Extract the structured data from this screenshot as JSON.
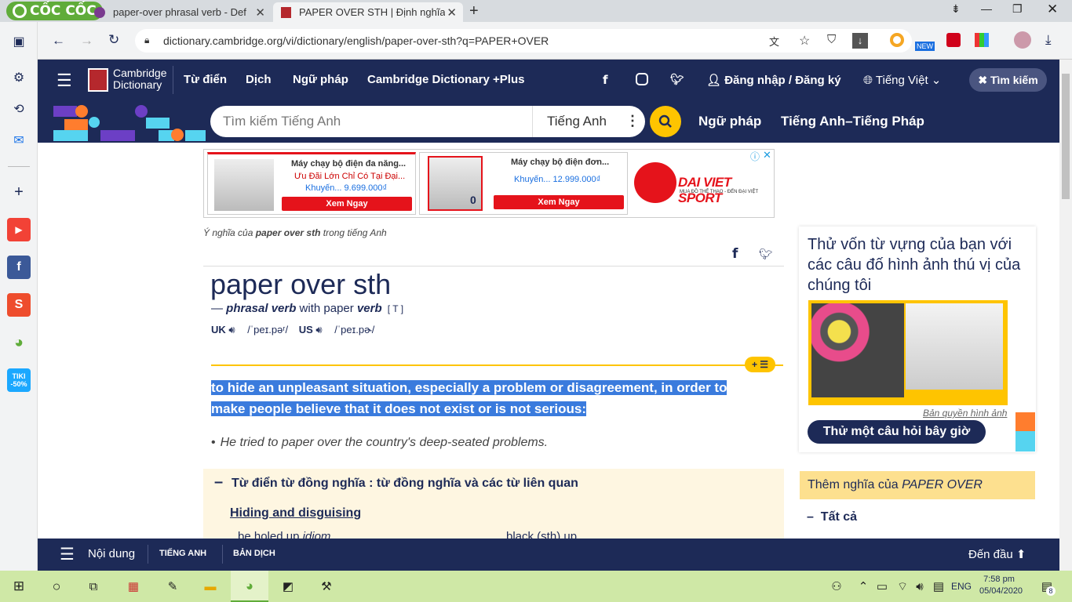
{
  "browser": {
    "brand": "CỐC CỐC",
    "tabs": [
      {
        "title": "paper-over phrasal verb - Def"
      },
      {
        "title": "PAPER OVER STH | Định nghĩa"
      }
    ],
    "url": "dictionary.cambridge.org/vi/dictionary/english/paper-over-sth?q=PAPER+OVER",
    "badge_new": "NEW",
    "sidebar_tiki": "TIKI -50%"
  },
  "site": {
    "logo_line1": "Cambridge",
    "logo_line2": "Dictionary",
    "nav": [
      "Từ điển",
      "Dịch",
      "Ngữ pháp",
      "Cambridge Dictionary +Plus"
    ],
    "login": "Đăng nhập / Đăng ký",
    "language": "Tiếng Việt",
    "search_toggle": "Tìm kiếm",
    "search_placeholder": "Tìm kiếm Tiếng Anh",
    "search_lang": "Tiếng Anh",
    "nav2": [
      "Ngữ pháp",
      "Tiếng Anh–Tiếng Pháp"
    ]
  },
  "ad": {
    "p1_title": "Máy chạy bộ điện đa năng...",
    "p1_sub": "Ưu Đãi Lớn Chỉ Có Tại Đại...",
    "p1_price": "Khuyến... 9.699.000₫",
    "p2_title": "Máy chạy bộ điện đơn...",
    "p2_price": "Khuyến... 12.999.000₫",
    "button": "Xem Ngay",
    "brand": "DAI VIET SPORT",
    "brand_sub": "MUA ĐỒ THỂ THAO - ĐẾN ĐẠI VIỆT",
    "p2_badge": "0"
  },
  "entry": {
    "breadcrumb_pre": "Ý nghĩa của ",
    "breadcrumb_word": "paper over sth",
    "breadcrumb_post": " trong tiếng Anh",
    "headword": "paper over sth",
    "dash": "— ",
    "pos": "phrasal verb",
    "with": " with paper ",
    "pos2": "verb",
    "grammar": "[ T ]",
    "uk": "UK",
    "uk_ipa": "/ˈpeɪ.pəʳ/",
    "us": "US",
    "us_ipa": "/ˈpeɪ.pɚ/",
    "definition": "to hide an unpleasant situation, especially a problem or disagreement, in order to make people believe that it does not exist or is not serious:",
    "example": "He tried to paper over the country's deep-seated problems.",
    "thesaurus_title": "Từ điển từ đồng nghĩa : từ đồng nghĩa và các từ liên quan",
    "thesaurus_link": "Hiding and disguising",
    "related1": "be holed up ",
    "related1_label": "idiom",
    "related2": "black (sth) up",
    "add_btn": "+ ☰"
  },
  "quiz": {
    "text": "Thử vốn từ vựng của bạn với các câu đố hình ảnh thú vị của chúng tôi",
    "copyright": "Bản quyền hình ảnh",
    "button": "Thử một câu hỏi bây giờ"
  },
  "more": {
    "title_pre": "Thêm nghĩa của ",
    "title_word": "PAPER OVER",
    "all": "Tất cả"
  },
  "bottombar": {
    "contents": "Nội dung",
    "tab1": "TIẾNG ANH",
    "tab2": "BẢN DỊCH",
    "top": "Đến đầu"
  },
  "taskbar": {
    "lang": "ENG",
    "time": "7:58 pm",
    "date": "05/04/2020",
    "notif": "8"
  }
}
